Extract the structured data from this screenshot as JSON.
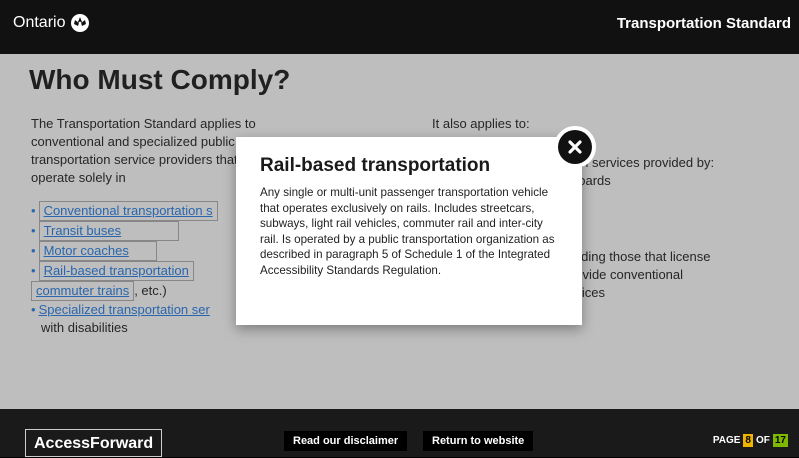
{
  "header": {
    "brand": "Ontario",
    "course_title": "Transportation Standard"
  },
  "slide": {
    "heading": "Who Must Comply?",
    "intro": "The Transportation Standard applies to conventional and specialized public transportation service providers that operate solely in",
    "left_list": {
      "item1": "Conventional transportation s",
      "sub1": "Transit buses",
      "sub2": "Motor coaches",
      "sub3": "Rail-based transportation",
      "sub3_cont_link": "commuter trains",
      "sub3_cont_tail": ", etc.)",
      "item2": "Specialized transportation ser",
      "item2_tail": "with disabilities"
    },
    "right": {
      "lead": "It also applies to:",
      "line1": "ion services provided by:",
      "line2": "boards",
      "line3": "luding those that license",
      "line4": "rovide conventional",
      "line5": "rvices"
    }
  },
  "dialog": {
    "title": "Rail-based transportation",
    "body": "Any single or multi-unit passenger transportation vehicle that operates exclusively on rails. Includes streetcars, subways, light rail vehicles, commuter rail and inter-city rail. Is operated by a public transportation organization as described in paragraph 5 of Schedule 1 of the Integrated Accessibility Standards Regulation.",
    "close_icon": "close-icon"
  },
  "footer": {
    "brand": "AccessForward",
    "disclaimer_label": "Read our disclaimer",
    "return_label": "Return to website",
    "page_label": "PAGE",
    "page_current": "8",
    "page_of": "OF",
    "page_total": "17"
  },
  "colors": {
    "link": "#2566b0",
    "page_current_bg": "#f0b400",
    "page_total_bg": "#7fb800"
  }
}
